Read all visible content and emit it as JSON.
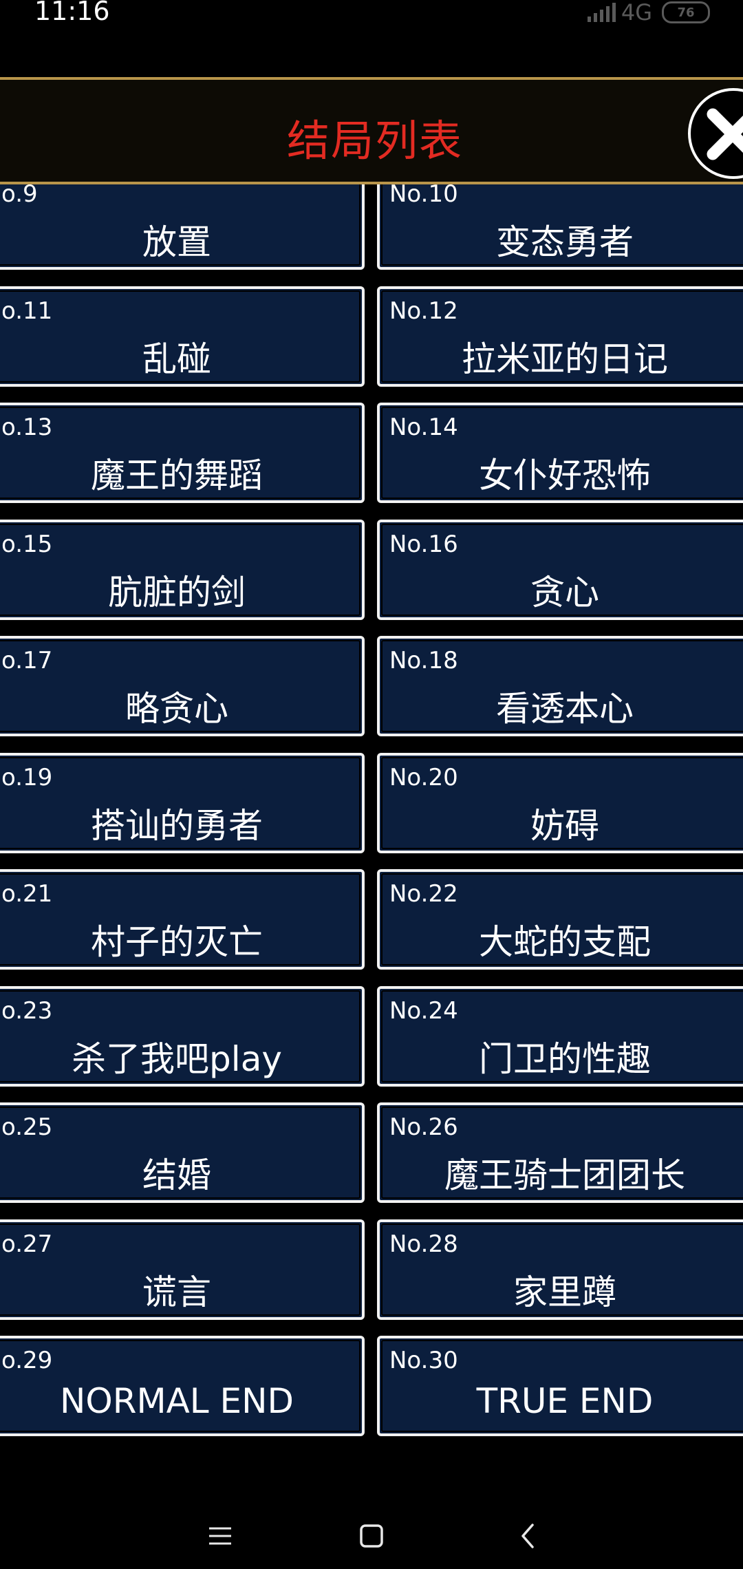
{
  "status_bar": {
    "time": "11:16",
    "network": "4G",
    "battery": "76"
  },
  "header": {
    "title": "结局列表"
  },
  "colors": {
    "background": "#000000",
    "header_bg": "#0d0b05",
    "header_border": "#b8954a",
    "title": "#e32b22",
    "card_bg": "#0b1e3d",
    "card_border": "#f2f2f2"
  },
  "endings": [
    {
      "number": "o.9",
      "title": "放置"
    },
    {
      "number": "No.10",
      "title": "变态勇者"
    },
    {
      "number": "o.11",
      "title": "乱碰"
    },
    {
      "number": "No.12",
      "title": "拉米亚的日记"
    },
    {
      "number": "o.13",
      "title": "魔王的舞蹈"
    },
    {
      "number": "No.14",
      "title": "女仆好恐怖"
    },
    {
      "number": "o.15",
      "title": "肮脏的剑"
    },
    {
      "number": "No.16",
      "title": "贪心"
    },
    {
      "number": "o.17",
      "title": "略贪心"
    },
    {
      "number": "No.18",
      "title": "看透本心"
    },
    {
      "number": "o.19",
      "title": "搭讪的勇者"
    },
    {
      "number": "No.20",
      "title": "妨碍"
    },
    {
      "number": "o.21",
      "title": "村子的灭亡"
    },
    {
      "number": "No.22",
      "title": "大蛇的支配"
    },
    {
      "number": "o.23",
      "title": "杀了我吧play"
    },
    {
      "number": "No.24",
      "title": "门卫的性趣"
    },
    {
      "number": "o.25",
      "title": "结婚"
    },
    {
      "number": "No.26",
      "title": "魔王骑士团团长"
    },
    {
      "number": "o.27",
      "title": "谎言"
    },
    {
      "number": "No.28",
      "title": "家里蹲"
    },
    {
      "number": "o.29",
      "title": "NORMAL END"
    },
    {
      "number": "No.30",
      "title": "TRUE END"
    }
  ],
  "nav": {
    "icons": [
      "menu-icon",
      "home-square-icon",
      "back-chevron-icon"
    ]
  }
}
